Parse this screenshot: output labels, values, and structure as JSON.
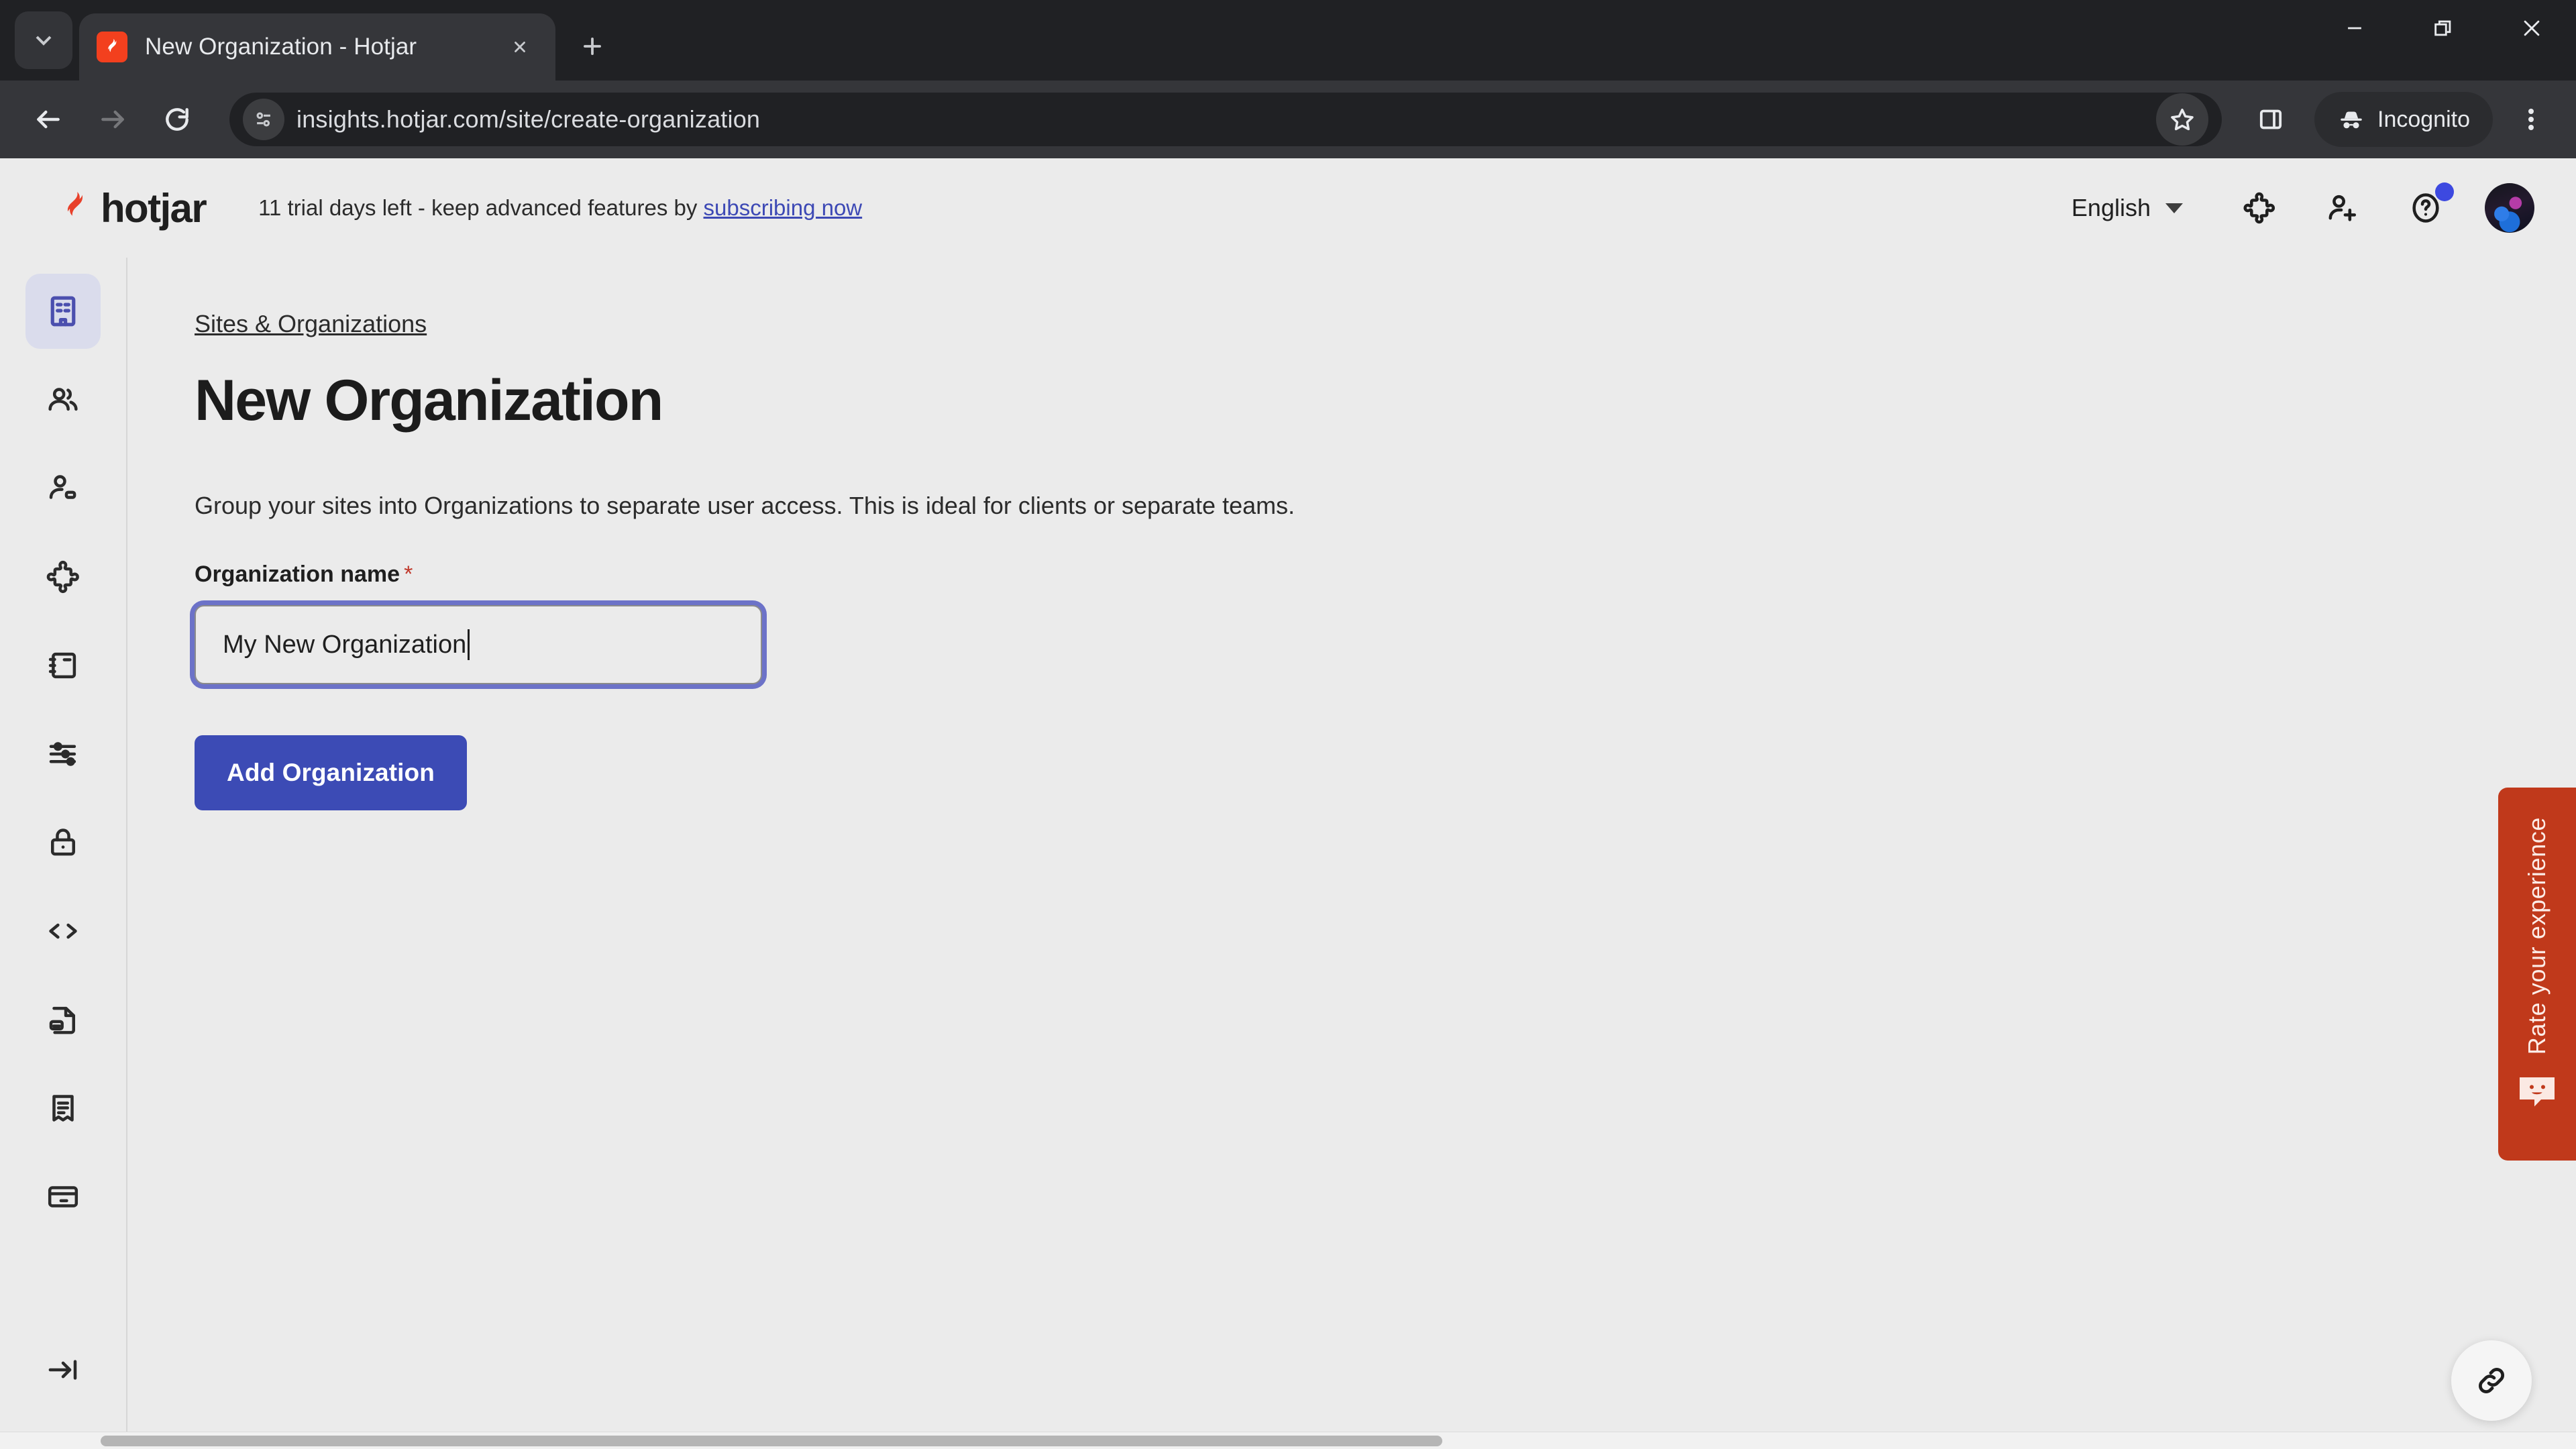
{
  "browser": {
    "tab": {
      "title": "New Organization - Hotjar",
      "favicon": "hotjar-flame-icon"
    },
    "tab_list_icon": "chevron-down-icon",
    "new_tab_icon": "plus-icon",
    "close_tab_icon": "close-icon",
    "window": {
      "minimize": "minimize-icon",
      "restore": "restore-icon",
      "close": "close-icon"
    },
    "nav": {
      "back": "back-arrow-icon",
      "forward": "forward-arrow-icon",
      "reload": "reload-icon"
    },
    "omnibox": {
      "url": "insights.hotjar.com/site/create-organization",
      "site_info_icon": "site-settings-icon",
      "bookmark_icon": "star-icon"
    },
    "toolbar": {
      "split_view_icon": "side-panel-icon",
      "incognito_label": "Incognito",
      "incognito_icon": "incognito-hat-icon",
      "menu_icon": "three-dot-menu-icon"
    }
  },
  "app": {
    "logo_text": "hotjar",
    "logo_icon": "hotjar-flame-icon",
    "trial": {
      "message": "11 trial days left - keep advanced features by",
      "link_label": "subscribing now"
    },
    "language": {
      "value": "English",
      "caret_icon": "chevron-down-icon"
    },
    "header_icons": [
      {
        "name": "integrations-puzzle-icon"
      },
      {
        "name": "invite-user-icon"
      },
      {
        "name": "help-question-icon",
        "badge": true
      }
    ],
    "avatar": "user-avatar"
  },
  "sidebar": {
    "items": [
      {
        "name": "sites-organizations",
        "icon": "building-icon",
        "active": true
      },
      {
        "name": "team",
        "icon": "users-icon",
        "active": false
      },
      {
        "name": "user-attributes",
        "icon": "user-settings-icon",
        "active": false
      },
      {
        "name": "integrations",
        "icon": "puzzle-icon",
        "active": false
      },
      {
        "name": "notes",
        "icon": "notebook-icon",
        "active": false
      },
      {
        "name": "settings-sliders",
        "icon": "sliders-icon",
        "active": false
      },
      {
        "name": "privacy",
        "icon": "lock-icon",
        "active": false
      },
      {
        "name": "tracking-code",
        "icon": "code-brackets-icon",
        "active": false
      },
      {
        "name": "billing-document",
        "icon": "document-card-icon",
        "active": false
      },
      {
        "name": "invoices",
        "icon": "receipt-icon",
        "active": false
      },
      {
        "name": "payment-methods",
        "icon": "credit-card-icon",
        "active": false
      }
    ],
    "expand": {
      "icon": "expand-sidebar-icon"
    }
  },
  "main": {
    "breadcrumb": "Sites & Organizations",
    "title": "New Organization",
    "description": "Group your sites into Organizations to separate user access. This is ideal for clients or separate teams.",
    "form": {
      "label": "Organization name",
      "required_mark": "*",
      "input_value": "My New Organization",
      "input_placeholder": "",
      "submit_label": "Add Organization"
    }
  },
  "widgets": {
    "rate": {
      "label": "Rate your experience",
      "icon": "smiley-face-icon",
      "color": "#c0391b"
    },
    "link_fab": {
      "icon": "chain-link-icon"
    }
  },
  "colors": {
    "accent": "#3c4bb5",
    "focus_ring": "#6c72c8",
    "sidebar_active_bg": "#dadcec",
    "page_bg": "#ebebeb",
    "chrome_bg": "#202124",
    "toolbar_bg": "#35363a",
    "link": "#3d49b5",
    "required": "#c0392b"
  }
}
